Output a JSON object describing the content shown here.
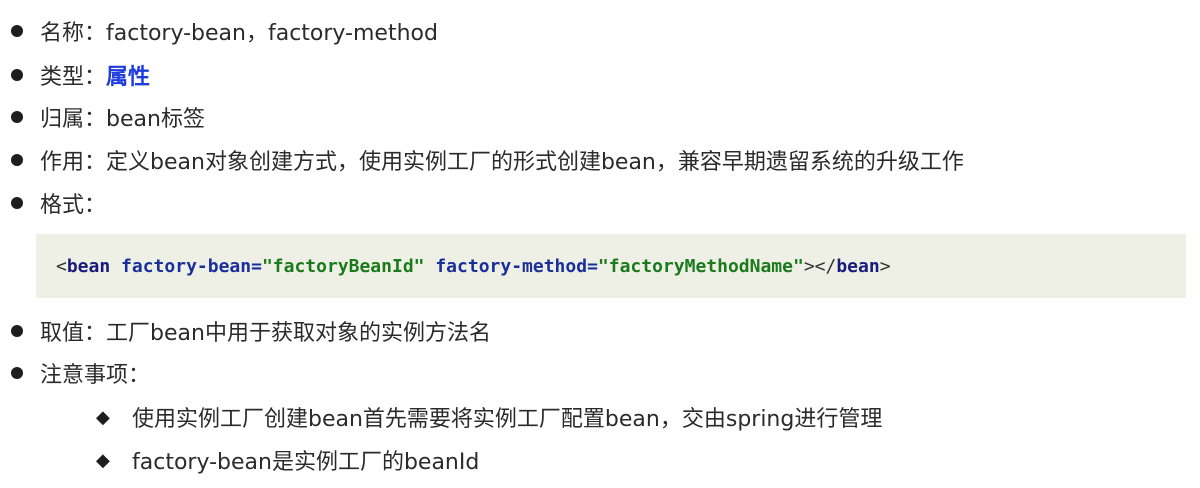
{
  "bullets": [
    {
      "label": "名称：",
      "value": "factory-bean，factory-method"
    },
    {
      "label": "类型：",
      "value": "属性"
    },
    {
      "label": "归属：",
      "value": "bean标签"
    },
    {
      "label": "作用：",
      "value": "定义bean对象创建方式，使用实例工厂的形式创建bean，兼容早期遗留系统的升级工作"
    },
    {
      "label": "格式：",
      "value": ""
    },
    {
      "label": "取值：",
      "value": "工厂bean中用于获取对象的实例方法名"
    },
    {
      "label": "注意事项：",
      "value": ""
    }
  ],
  "code": {
    "open_bracket": "<",
    "tag": "bean",
    "attr1_name": "factory-bean",
    "eq1": "=",
    "attr1_value": "\"factoryBeanId\"",
    "attr2_name": "factory-method",
    "eq2": "=",
    "attr2_value": "\"factoryMethodName\"",
    "close_open": "></",
    "close_tag": "bean",
    "close_bracket": ">"
  },
  "notes": [
    "使用实例工厂创建bean首先需要将实例工厂配置bean，交由spring进行管理",
    "factory-bean是实例工厂的beanId"
  ],
  "symbols": {
    "diamond": "◆"
  },
  "colors": {
    "highlight": "#1f3ce0",
    "code_background": "#eef0e6",
    "code_string": "#1b7a1b",
    "code_keyword": "#1a2f99"
  }
}
